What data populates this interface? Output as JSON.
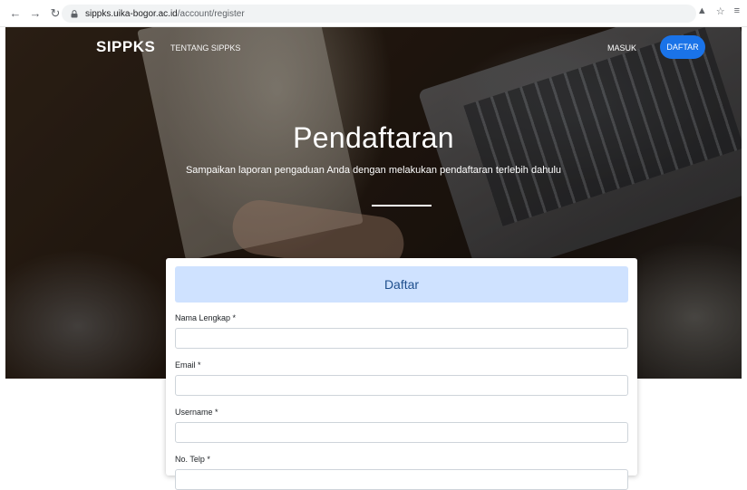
{
  "browser": {
    "url_host": "sippks.uika-bogor.ac.id",
    "url_path": "/account/register",
    "icons": [
      "back-arrow-icon",
      "forward-arrow-icon",
      "reload-icon",
      "lock-icon",
      "share-icon",
      "star-icon",
      "reading-list-icon"
    ]
  },
  "navbar": {
    "brand": "SIPPKS",
    "about_link": "TENTANG SIPPKS",
    "login_link": "MASUK",
    "register_button": "DAFTAR"
  },
  "hero": {
    "title": "Pendaftaran",
    "subtitle": "Sampaikan laporan pengaduan Anda dengan melakukan pendaftaran terlebih dahulu"
  },
  "form": {
    "header": "Daftar",
    "fields": [
      {
        "label": "Nama Lengkap *",
        "value": ""
      },
      {
        "label": "Email *",
        "value": ""
      },
      {
        "label": "Username *",
        "value": ""
      },
      {
        "label": "No. Telp *",
        "value": ""
      }
    ]
  },
  "colors": {
    "primary_button": "#1a73e8",
    "card_header_bg": "#cfe2ff",
    "card_header_text": "#1f4f8c"
  }
}
